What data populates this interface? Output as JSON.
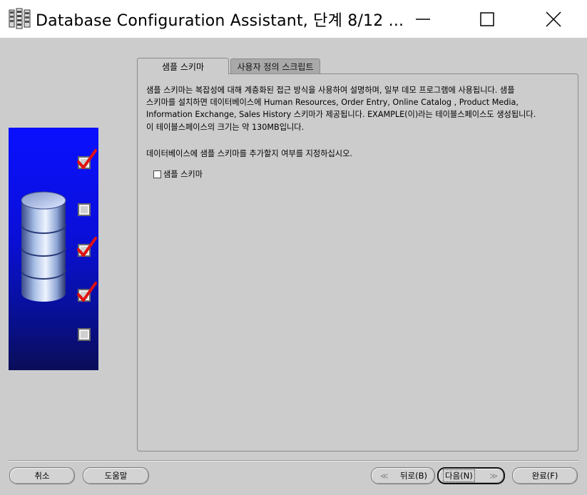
{
  "window": {
    "title": "Database Configuration Assistant, 단계 8/12 ..."
  },
  "steps": [
    {
      "state": "checked"
    },
    {
      "state": "unchecked"
    },
    {
      "state": "checked"
    },
    {
      "state": "checked"
    },
    {
      "state": "unchecked"
    }
  ],
  "tabs": [
    {
      "label": "샘플 스키마",
      "active": true
    },
    {
      "label": "사용자 정의 스크립트",
      "active": false
    }
  ],
  "panel": {
    "description_lines": [
      "샘플 스키마는 복잡성에 대해 계층화된 접근 방식을 사용하여 설명하며, 일부 데모 프로그램에 사용됩니다. 샘플",
      "스키마를 설치하면 데이터베이스에 Human Resources, Order Entry, Online Catalog , Product Media,",
      "Information Exchange, Sales History 스키마가 제공됩니다. EXAMPLE(이)라는 테이블스페이스도 생성됩니다.",
      "이 테이블스페이스의 크기는 약 130MB입니다."
    ],
    "prompt": "데이터베이스에 샘플 스키마를 추가할지 여부를 지정하십시오.",
    "checkbox_label": "샘플 스키마",
    "checkbox_checked": false
  },
  "buttons": {
    "cancel": "취소",
    "help": "도움말",
    "back": "뒤로(B)",
    "next": "다음(N)",
    "finish": "완료(F)"
  },
  "colors": {
    "dialog_bg": "#cccccc",
    "check_red": "#e01010",
    "side_blue": "#0a10ff"
  }
}
